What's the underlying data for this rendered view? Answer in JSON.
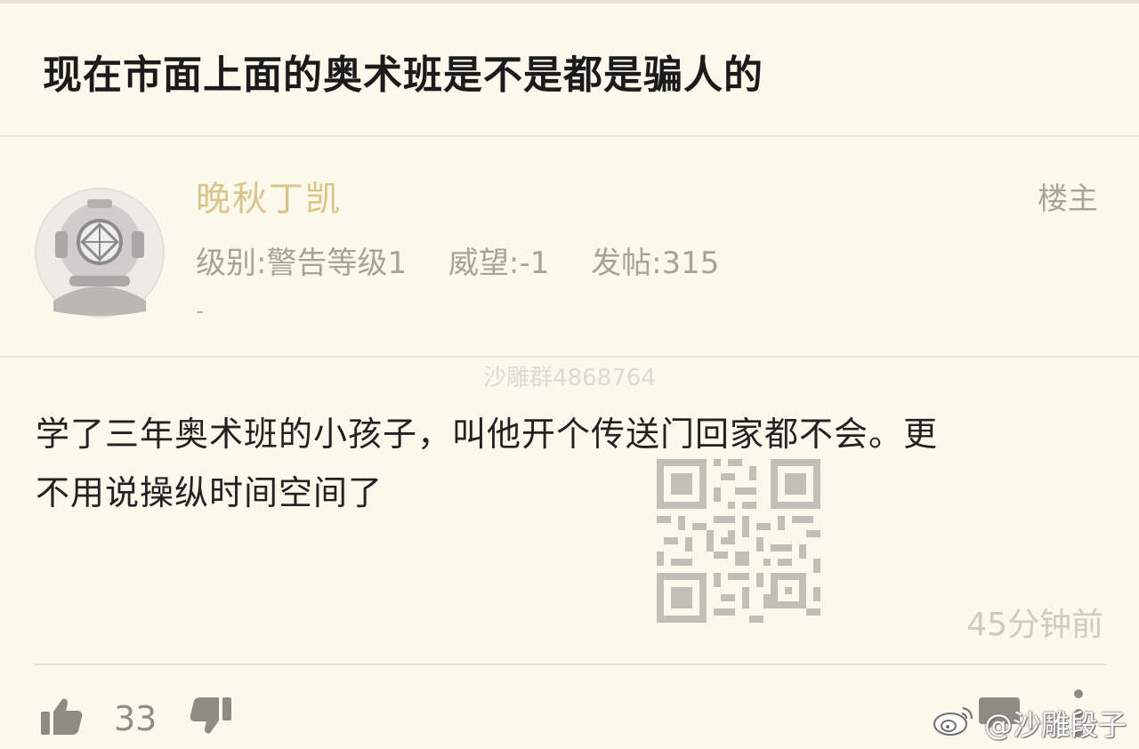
{
  "thread": {
    "title": "现在市面上面的奥术班是不是都是骗人的"
  },
  "post": {
    "author": {
      "name": "晚秋丁凯",
      "avatar_icon": "diving-helmet-icon"
    },
    "badge": "楼主",
    "meta": {
      "level": "级别:警告等级1",
      "prestige": "威望:-1",
      "posts": "发帖:315"
    },
    "signature": "-",
    "group_watermark": "沙雕群4868764",
    "body_line1": "学了三年奥术班的小孩子，叫他开个传送门回家都不会。更",
    "body_line2": "不用说操纵时间空间了",
    "qr_icon": "qr-code-icon",
    "time_ago": "45分钟前",
    "likes": "33"
  },
  "footer": {
    "like_icon": "thumbs-up-icon",
    "dislike_icon": "thumbs-down-icon",
    "reply_icon": "reply-icon",
    "more_icon": "more-icon",
    "weibo_logo": "weibo-logo-icon",
    "weibo_watermark": "@沙雕段子"
  },
  "colors": {
    "background": "#fbf8ec",
    "author_name": "#d9c58a",
    "title": "#1b1b1b",
    "meta": "#a6a399"
  }
}
